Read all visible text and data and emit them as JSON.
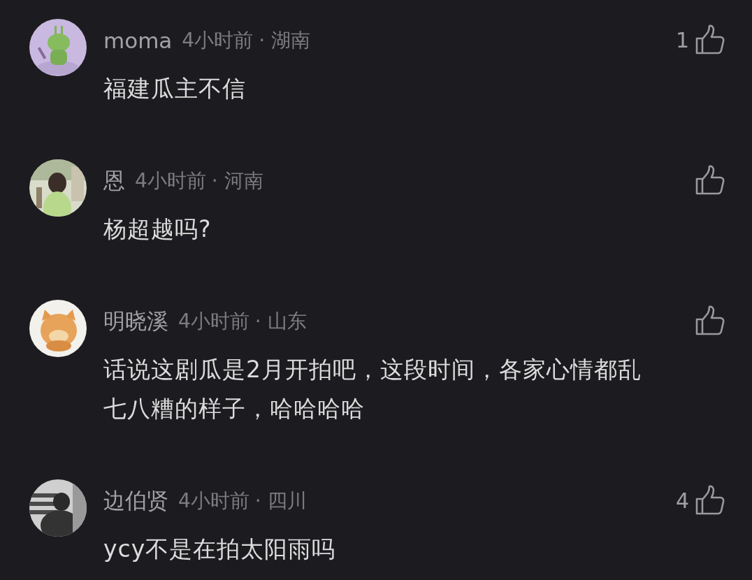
{
  "comments": [
    {
      "user": "moma",
      "time": "4小时前",
      "location": "· 湖南",
      "text": "福建瓜主不信",
      "likes": "1"
    },
    {
      "user": "恩",
      "time": "4小时前",
      "location": "· 河南",
      "text": "杨超越吗?"
    },
    {
      "user": "明晓溪",
      "time": "4小时前",
      "location": "· 山东",
      "text": "话说这剧瓜是2月开拍吧，这段时间，各家心情都乱七八糟的样子，哈哈哈哈"
    },
    {
      "user": "边伯贤",
      "time": "4小时前",
      "location": "· 四川",
      "text": "ycy不是在拍太阳雨吗",
      "likes": "4"
    }
  ]
}
